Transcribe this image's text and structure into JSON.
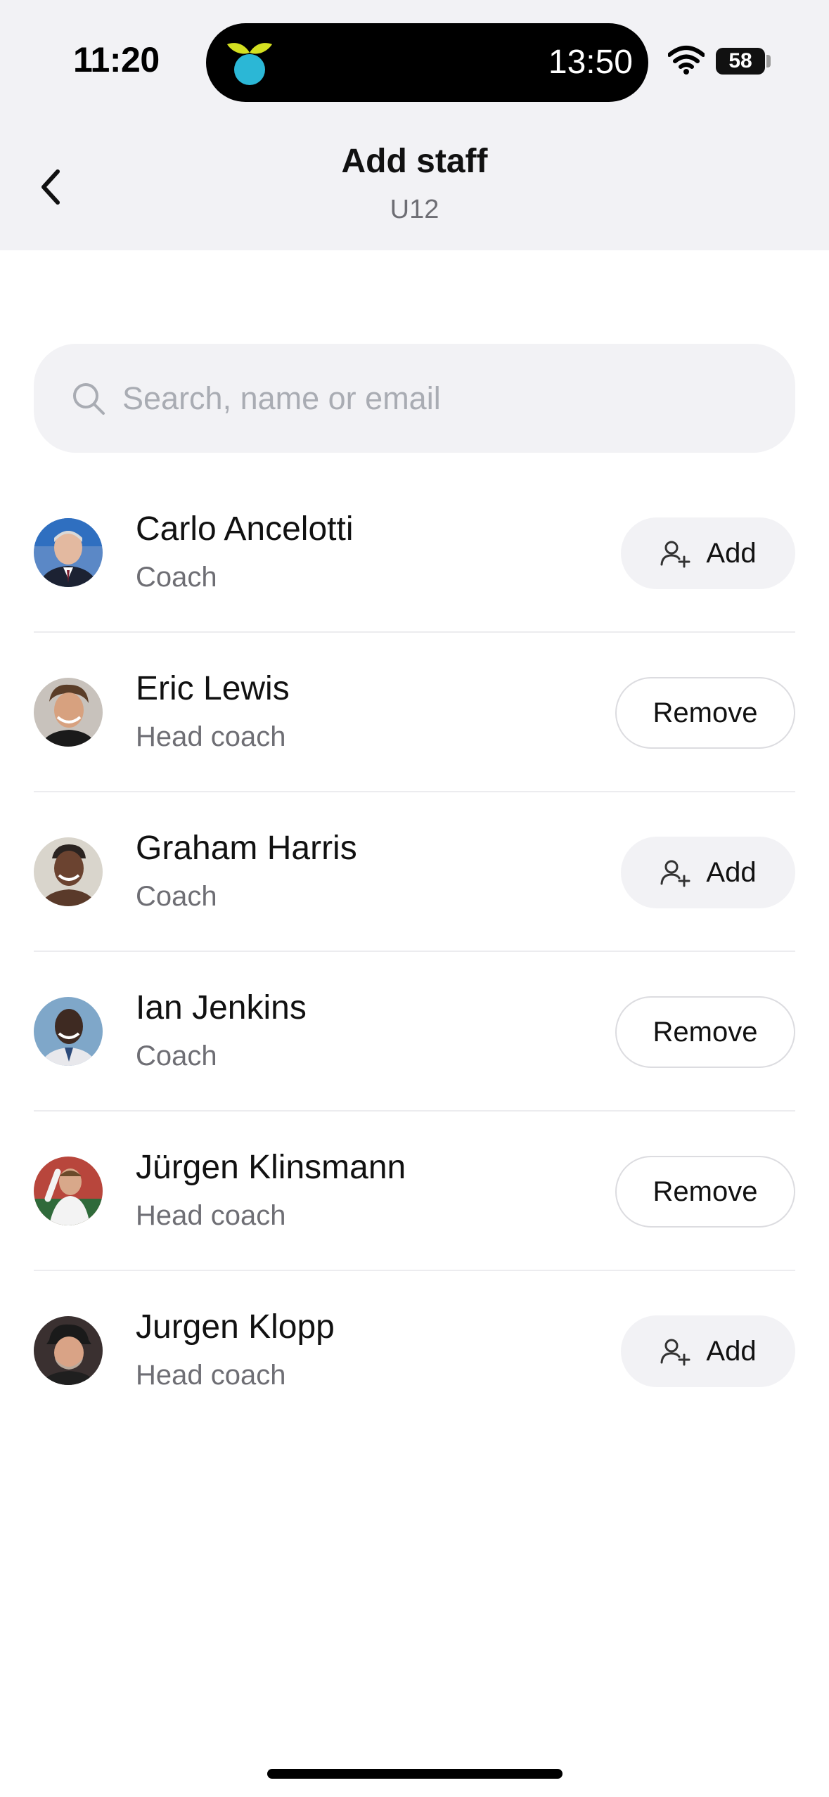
{
  "status_bar": {
    "time": "11:20",
    "island_time": "13:50",
    "battery": "58"
  },
  "header": {
    "title": "Add staff",
    "subtitle": "U12"
  },
  "search": {
    "placeholder": "Search, name or email"
  },
  "staff": [
    {
      "name": "Carlo Ancelotti",
      "role": "Coach",
      "action": "Add"
    },
    {
      "name": "Eric Lewis",
      "role": "Head coach",
      "action": "Remove"
    },
    {
      "name": "Graham Harris",
      "role": "Coach",
      "action": "Add"
    },
    {
      "name": "Ian Jenkins",
      "role": "Coach",
      "action": "Remove"
    },
    {
      "name": "Jürgen Klinsmann",
      "role": "Head coach",
      "action": "Remove"
    },
    {
      "name": "Jurgen Klopp",
      "role": "Head coach",
      "action": "Add"
    }
  ],
  "colors": {
    "header_bg": "#f2f2f5",
    "search_bg": "#f2f2f5",
    "add_button_bg": "#f2f2f5",
    "secondary_text": "#6e6e74",
    "placeholder_text": "#a9acb3",
    "divider": "#ececef",
    "logo_leaf": "#d4e021",
    "logo_body": "#2bb7d6"
  },
  "icons": {
    "back": "chevron-left-icon",
    "search": "search-icon",
    "add": "add-user-icon",
    "wifi": "wifi-icon"
  }
}
